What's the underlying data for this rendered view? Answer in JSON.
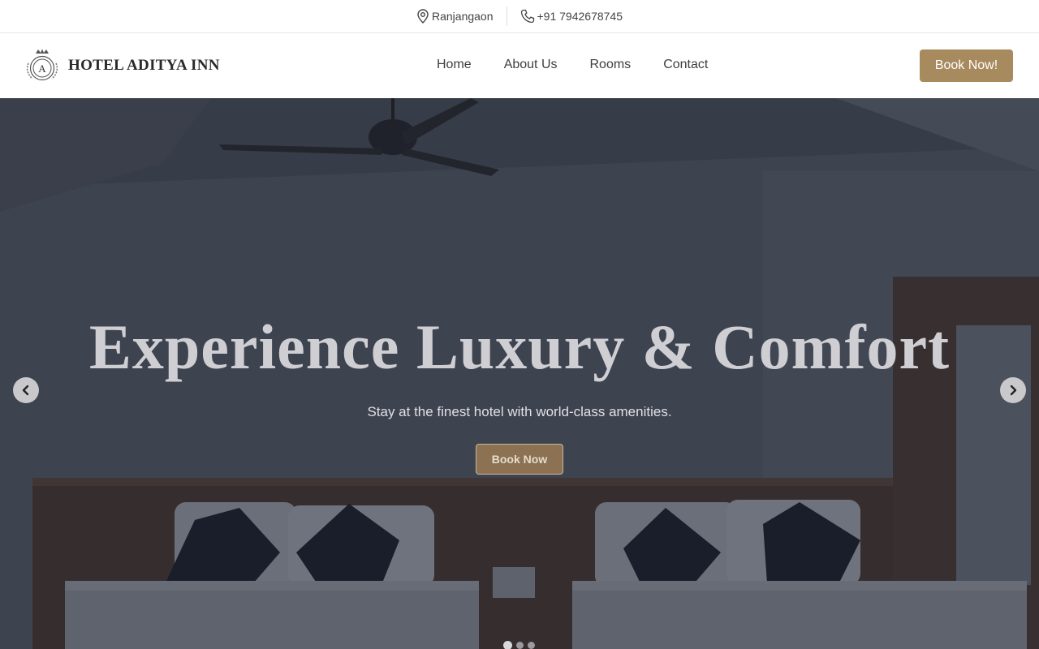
{
  "topbar": {
    "location": "Ranjangaon",
    "phone": "+91 7942678745"
  },
  "navbar": {
    "brand": "HOTEL ADITYA INN",
    "logo_letter": "A",
    "links": [
      "Home",
      "About Us",
      "Rooms",
      "Contact"
    ],
    "book_label": "Book Now!"
  },
  "hero": {
    "title": "Experience Luxury & Comfort",
    "subtitle": "Stay at the finest hotel with world-class amenities.",
    "button_label": "Book Now",
    "slides": 3,
    "active_slide": 1
  },
  "colors": {
    "accent": "#a88a5f",
    "overlay": "#181c28"
  }
}
